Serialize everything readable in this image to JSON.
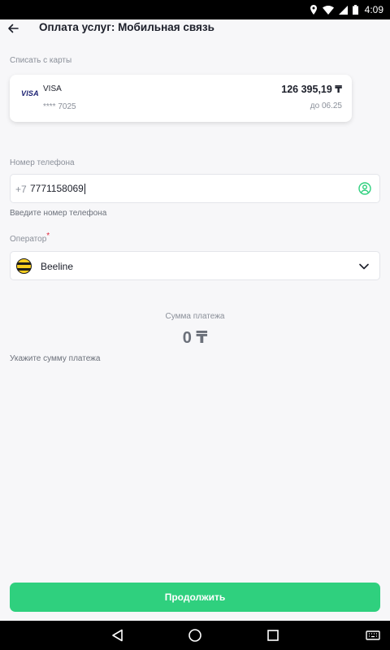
{
  "status_bar": {
    "time": "4:09"
  },
  "header": {
    "title": "Оплата услуг: Мобильная связь"
  },
  "card_section": {
    "label": "Списать с карты",
    "card": {
      "logo_text": "VISA",
      "brand": "VISA",
      "masked_number": "**** 7025",
      "balance": "126 395,19 ₸",
      "expiry": "до 06.25"
    }
  },
  "phone_section": {
    "label": "Номер телефона",
    "prefix": "+7",
    "value": "7771158069",
    "hint": "Введите номер телефона"
  },
  "operator_section": {
    "label": "Оператор",
    "required_mark": "*",
    "selected": "Beeline"
  },
  "amount_section": {
    "label": "Сумма платежа",
    "value": "0 ₸",
    "hint": "Укажите сумму платежа"
  },
  "footer": {
    "continue_label": "Продолжить"
  },
  "colors": {
    "accent": "#2fd07e",
    "required": "#e0283c",
    "visa_blue": "#1a1f71"
  }
}
